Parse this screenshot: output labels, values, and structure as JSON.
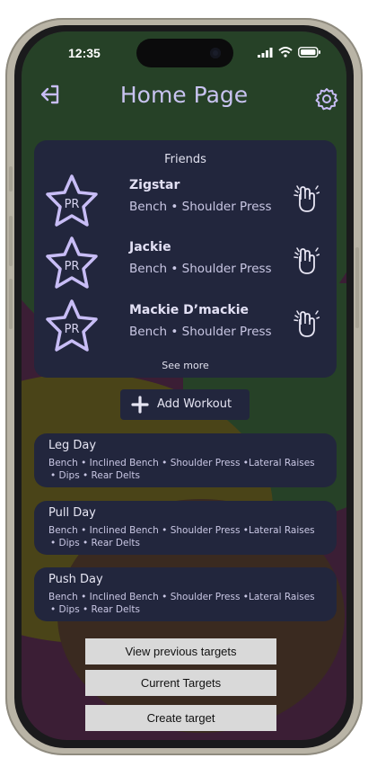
{
  "status_bar": {
    "time": "12:35"
  },
  "header": {
    "title": "Home Page"
  },
  "friends": {
    "title": "Friends",
    "badge_text": "PR",
    "items": [
      {
        "name": "Zigstar",
        "exercises": "Bench • Shoulder Press"
      },
      {
        "name": "Jackie",
        "exercises": "Bench • Shoulder Press"
      },
      {
        "name": "Mackie D’mackie",
        "exercises": "Bench • Shoulder Press"
      }
    ],
    "see_more": "See more"
  },
  "add_workout": {
    "label": "Add Workout"
  },
  "workouts": [
    {
      "name": "Leg Day",
      "line1": "Bench • Inclined Bench • Shoulder Press •Lateral Raises",
      "line2": "• Dips • Rear Delts"
    },
    {
      "name": "Pull Day",
      "line1": "Bench • Inclined Bench • Shoulder Press •Lateral Raises",
      "line2": "• Dips • Rear Delts"
    },
    {
      "name": "Push Day",
      "line1": "Bench • Inclined Bench • Shoulder Press •Lateral Raises",
      "line2": "• Dips • Rear Delts"
    }
  ],
  "targets": {
    "view_previous": "View previous targets",
    "current": "Current Targets",
    "create": "Create target"
  },
  "colors": {
    "accent": "#c8bdf6",
    "card": "#22263d",
    "button": "#d9d9d9"
  },
  "icons": [
    "logout-icon",
    "gear-icon",
    "star-icon",
    "clapping-hands-icon",
    "plus-icon",
    "signal-icon",
    "wifi-icon",
    "battery-icon"
  ]
}
